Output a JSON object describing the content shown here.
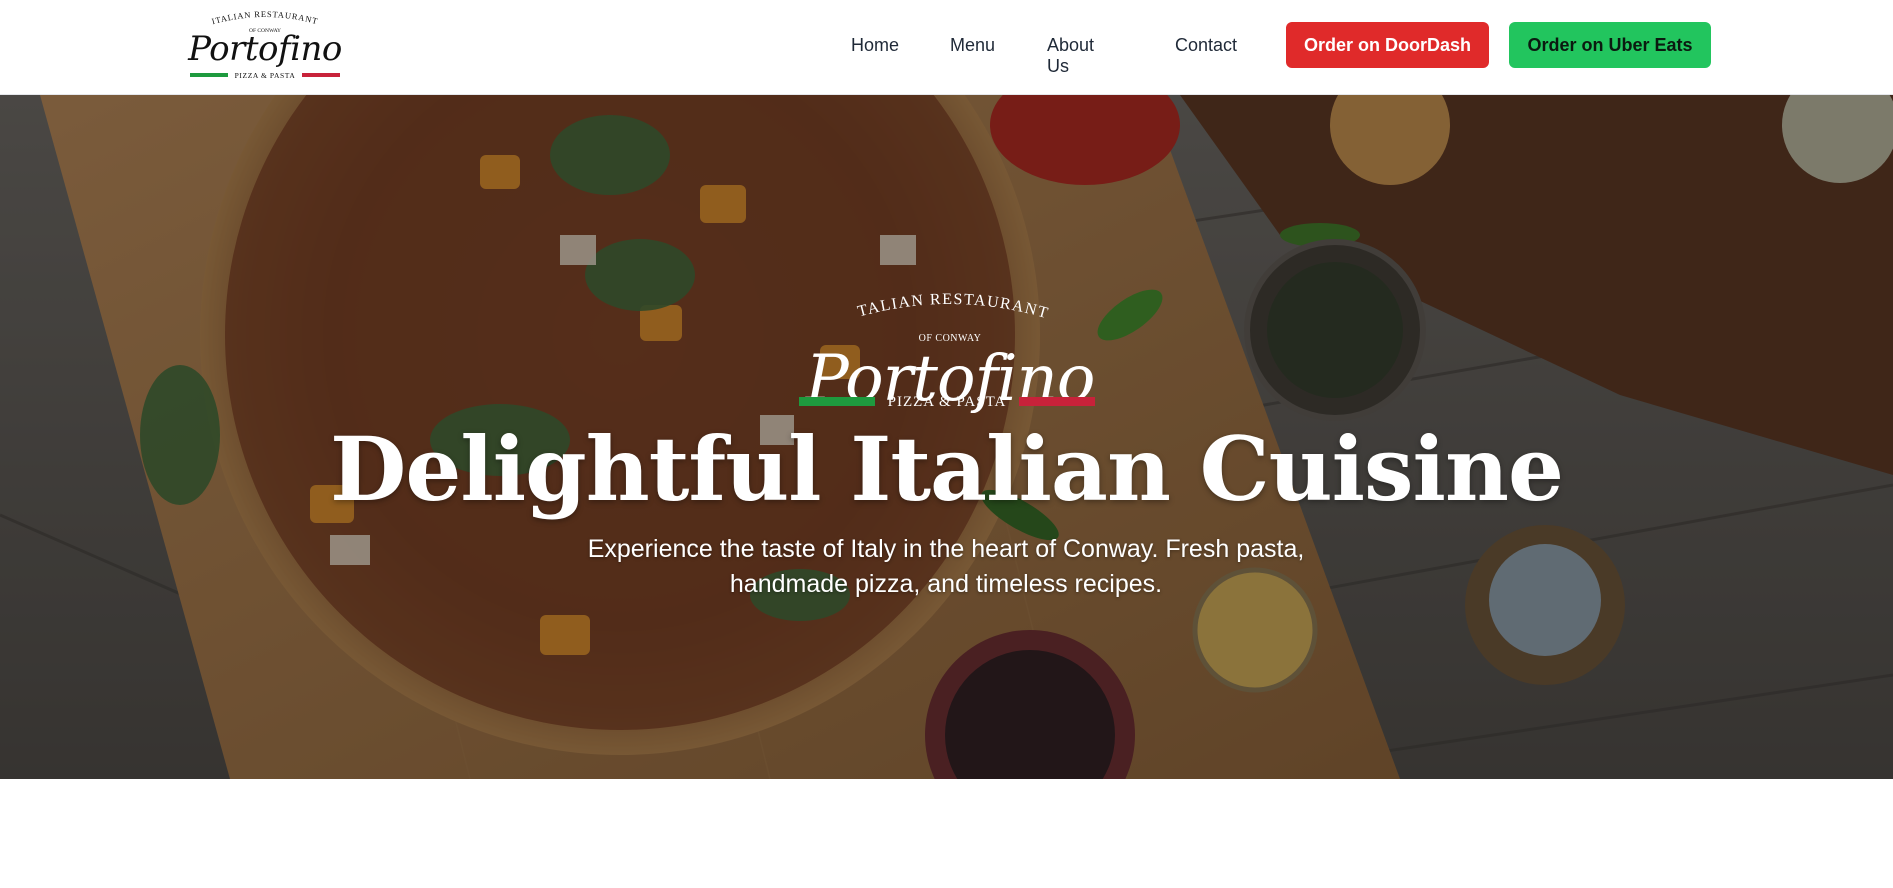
{
  "brand": {
    "arc_line1": "ITALIAN RESTAURANT",
    "arc_line2": "OF CONWAY",
    "name": "Portofino",
    "tagline": "PIZZA & PASTA",
    "colors": {
      "green": "#1e9a3e",
      "red": "#c8223a"
    }
  },
  "nav": {
    "links": [
      {
        "label": "Home"
      },
      {
        "label": "Menu"
      },
      {
        "label": "About Us"
      },
      {
        "label": "Contact"
      }
    ],
    "doordash_label": "Order on DoorDash",
    "ubereats_label": "Order on Uber Eats",
    "doordash_color": "#e02a2a",
    "ubereats_color": "#22c55e"
  },
  "hero": {
    "title": "Delightful Italian Cuisine",
    "subtitle_line1": "Experience the taste of Italy in the heart of Conway. Fresh pasta,",
    "subtitle_line2": "handmade pizza, and timeless recipes."
  }
}
